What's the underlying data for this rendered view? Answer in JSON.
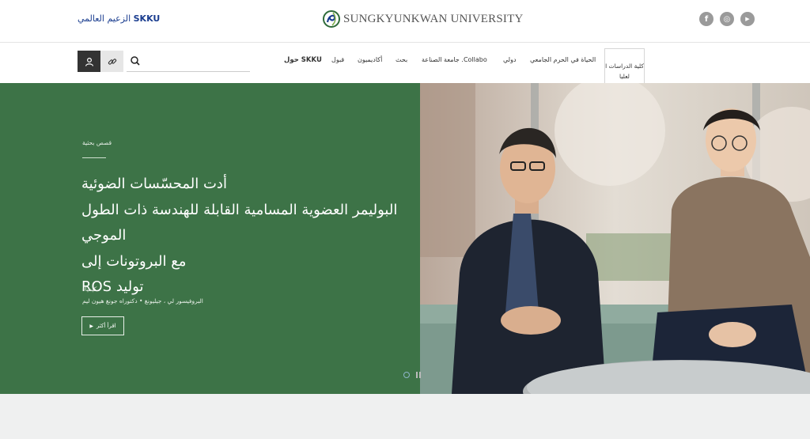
{
  "header": {
    "global_link_bold": "SKKU",
    "global_link_text": "الزعيم العالمي",
    "logo_text": "SUNGKYUNKWAN UNIVERSITY",
    "socials": [
      {
        "icon": "facebook-icon",
        "glyph": "f"
      },
      {
        "icon": "instagram-icon",
        "glyph": "◎"
      },
      {
        "icon": "youtube-icon",
        "glyph": "▶"
      }
    ]
  },
  "nav": {
    "search_placeholder": "",
    "items": [
      {
        "label": "SKKU حول",
        "bold": true
      },
      {
        "label": "قبول",
        "bold": false
      },
      {
        "label": "أكاديميون",
        "bold": false
      },
      {
        "label": "بحث",
        "bold": false
      },
      {
        "label": "Collabo. جامعة الصناعة",
        "bold": false
      },
      {
        "label": "دولي",
        "bold": false
      },
      {
        "label": "الحياة في الحرم الجامعي",
        "bold": false
      }
    ],
    "box_label_line1": "كلية الدراسات ا",
    "box_label_line2": "لعليا"
  },
  "hero": {
    "category": "قصص بحثية",
    "title_lines": [
      "أدت المحسّسات الضوئية",
      "البوليمر العضوية المسامية القابلة للهندسة ذات الطول الموجي",
      "مع البروتونات إلى",
      "توليد ROS"
    ],
    "department": "كيمياء",
    "authors": "البروفيسور لي ، جيليونغ • دكتوراه جونغ هيون ليم",
    "read_more": "اقرأ أكثر",
    "colors": {
      "panel": "#3d7347",
      "brand": "#1a3d8f"
    }
  }
}
